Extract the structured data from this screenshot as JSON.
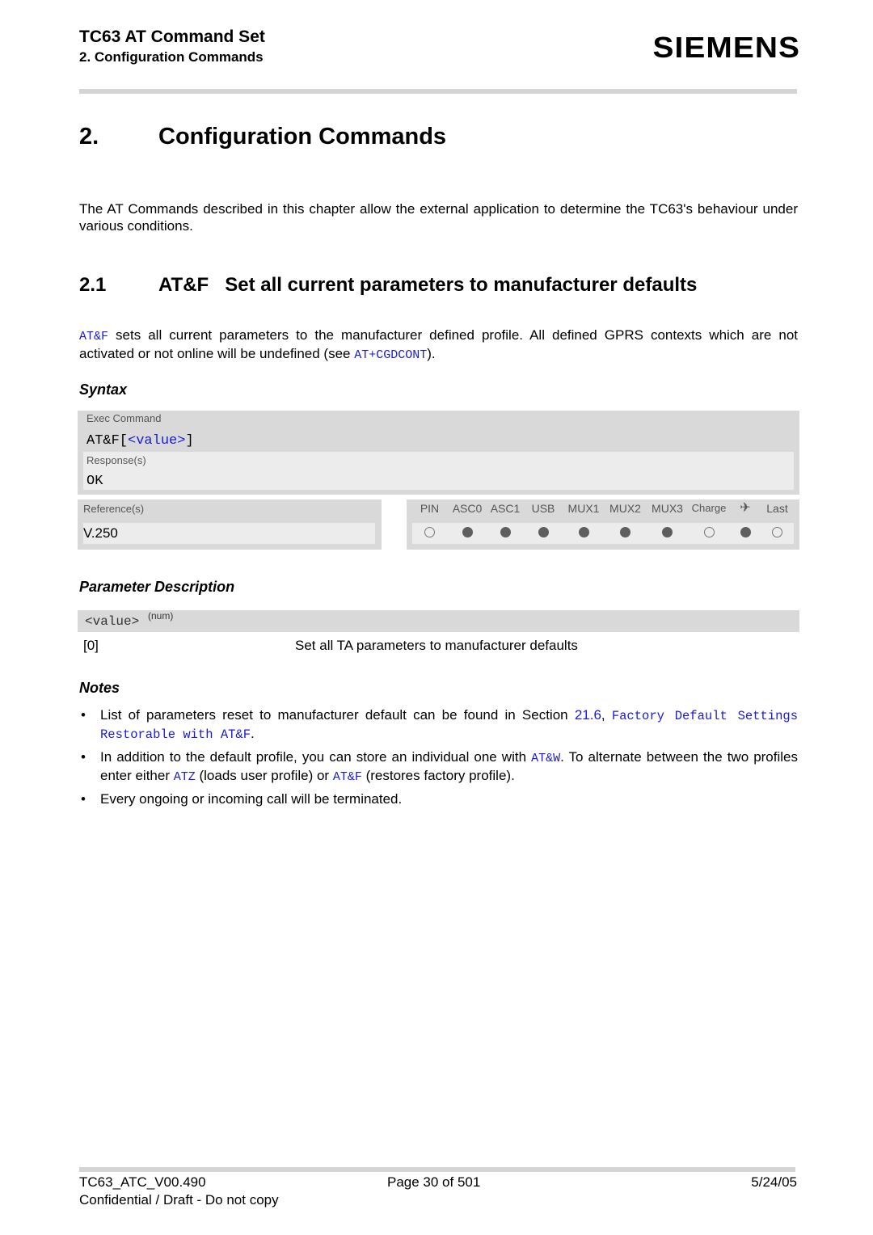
{
  "header": {
    "doc_title": "TC63 AT Command Set",
    "chapter_ref": "2. Configuration Commands",
    "brand": "SIEMENS"
  },
  "chapter": {
    "number": "2.",
    "title": "Configuration Commands",
    "intro": "The AT Commands described in this chapter allow the external application to determine the TC63's behaviour under various conditions."
  },
  "section": {
    "number": "2.1",
    "title": "AT&F   Set all current parameters to manufacturer defaults",
    "desc_cmd": "AT&F",
    "desc_text_1": " sets all current parameters to the manufacturer defined profile. All defined GPRS contexts which are not activated or not online will be undefined (see ",
    "desc_link": "AT+CGDCONT",
    "desc_text_2": ")."
  },
  "syntax": {
    "heading": "Syntax",
    "exec_label": "Exec Command",
    "exec_cmd_prefix": "AT&F[",
    "exec_cmd_param": "<value>",
    "exec_cmd_suffix": "]",
    "responses_label": "Response(s)",
    "response": "OK",
    "references_label": "Reference(s)",
    "reference": "V.250",
    "modes": [
      {
        "label": "PIN",
        "supported": false
      },
      {
        "label": "ASC0",
        "supported": true
      },
      {
        "label": "ASC1",
        "supported": true
      },
      {
        "label": "USB",
        "supported": true
      },
      {
        "label": "MUX1",
        "supported": true
      },
      {
        "label": "MUX2",
        "supported": true
      },
      {
        "label": "MUX3",
        "supported": true
      },
      {
        "label": "Charge",
        "supported": false
      },
      {
        "label": "✈",
        "icon": "airplane-icon",
        "supported": true
      },
      {
        "label": "Last",
        "supported": false
      }
    ]
  },
  "parameters": {
    "heading": "Parameter Description",
    "param_name": "<value>",
    "param_type": "(num)",
    "values": [
      {
        "value": "[0]",
        "description": "Set all TA parameters to manufacturer defaults"
      }
    ]
  },
  "notes": {
    "heading": "Notes",
    "n1_text": "List of parameters reset to manufacturer default can be found in Section ",
    "n1_link_num": "21.6",
    "n1_sep": ", ",
    "n1_link_title": "Factory Default Settings Restorable with AT&F",
    "n1_end": ".",
    "n2_text_1": "In addition to the default profile, you can store an individual one with ",
    "n2_link_1": "AT&W",
    "n2_text_2": ". To alternate between the two profiles enter either ",
    "n2_link_2": "ATZ",
    "n2_text_3": " (loads user profile) or ",
    "n2_link_3": "AT&F",
    "n2_text_4": " (restores factory profile).",
    "n3_text": "Every ongoing or incoming call will be terminated."
  },
  "footer": {
    "doc_id": "TC63_ATC_V00.490",
    "page": "Page 30 of 501",
    "date": "5/24/05",
    "confidential": "Confidential / Draft - Do not copy"
  }
}
